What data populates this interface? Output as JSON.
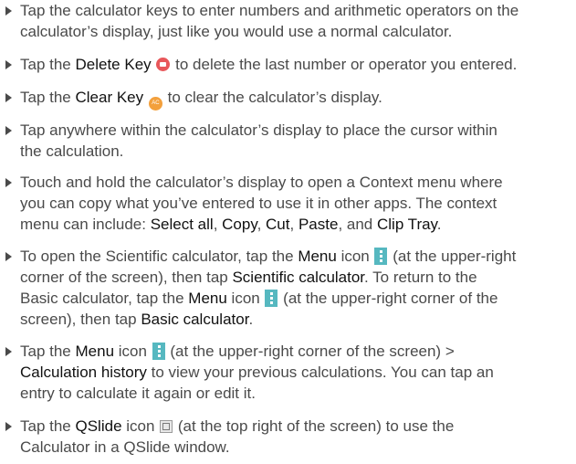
{
  "items": [
    {
      "lines": [
        [
          {
            "t": "Tap the calculator keys to enter numbers and arithmetic operators on the"
          }
        ],
        [
          {
            "t": "calculator’s display, just like you would use a normal calculator."
          }
        ]
      ]
    },
    {
      "lines": [
        [
          {
            "t": "Tap the "
          },
          {
            "t": "Delete Key",
            "b": 1
          },
          {
            "t": " "
          },
          {
            "icon": "delete-key-icon"
          },
          {
            "t": " to delete the last number or operator you entered."
          }
        ]
      ]
    },
    {
      "lines": [
        [
          {
            "t": "Tap the "
          },
          {
            "t": "Clear Key",
            "b": 1
          },
          {
            "t": " "
          },
          {
            "icon": "clear-key-icon"
          },
          {
            "t": " to clear the calculator’s display."
          }
        ]
      ]
    },
    {
      "lines": [
        [
          {
            "t": "Tap anywhere within the calculator’s display to place the cursor within"
          }
        ],
        [
          {
            "t": "the calculation."
          }
        ]
      ]
    },
    {
      "lines": [
        [
          {
            "t": "Touch and hold the calculator’s display to open a Context menu where"
          }
        ],
        [
          {
            "t": "you can copy what you’ve entered to use it in other apps. The context"
          }
        ],
        [
          {
            "t": "menu can include: "
          },
          {
            "t": "Select all",
            "b": 1
          },
          {
            "t": ", "
          },
          {
            "t": "Copy",
            "b": 1
          },
          {
            "t": ", "
          },
          {
            "t": "Cut",
            "b": 1
          },
          {
            "t": ", "
          },
          {
            "t": "Paste",
            "b": 1
          },
          {
            "t": ", and "
          },
          {
            "t": "Clip Tray",
            "b": 1
          },
          {
            "t": "."
          }
        ]
      ]
    },
    {
      "lines": [
        [
          {
            "t": "To open the Scientific calculator, tap the "
          },
          {
            "t": "Menu",
            "b": 1
          },
          {
            "t": " icon "
          },
          {
            "icon": "menu-icon"
          },
          {
            "t": " (at the upper-right"
          }
        ],
        [
          {
            "t": "corner of the screen), then tap "
          },
          {
            "t": "Scientific calculator",
            "b": 1
          },
          {
            "t": ". To return to the"
          }
        ],
        [
          {
            "t": "Basic calculator, tap the "
          },
          {
            "t": "Menu",
            "b": 1
          },
          {
            "t": " icon "
          },
          {
            "icon": "menu-icon"
          },
          {
            "t": " (at the upper-right corner of the"
          }
        ],
        [
          {
            "t": "screen), then tap "
          },
          {
            "t": "Basic calculator",
            "b": 1
          },
          {
            "t": "."
          }
        ]
      ]
    },
    {
      "lines": [
        [
          {
            "t": "Tap the "
          },
          {
            "t": "Menu",
            "b": 1
          },
          {
            "t": " icon "
          },
          {
            "icon": "menu-icon"
          },
          {
            "t": " (at the upper-right corner of the screen) >"
          }
        ],
        [
          {
            "t": "Calculation history",
            "b": 1
          },
          {
            "t": " to view your previous calculations. You can tap an"
          }
        ],
        [
          {
            "t": "entry to calculate it again or edit it."
          }
        ]
      ]
    },
    {
      "lines": [
        [
          {
            "t": "Tap the "
          },
          {
            "t": "QSlide",
            "b": 1
          },
          {
            "t": " icon "
          },
          {
            "icon": "qslide-icon"
          },
          {
            "t": " (at the top right of the screen) to use the"
          }
        ],
        [
          {
            "t": "Calculator in a QSlide window."
          }
        ]
      ]
    }
  ]
}
